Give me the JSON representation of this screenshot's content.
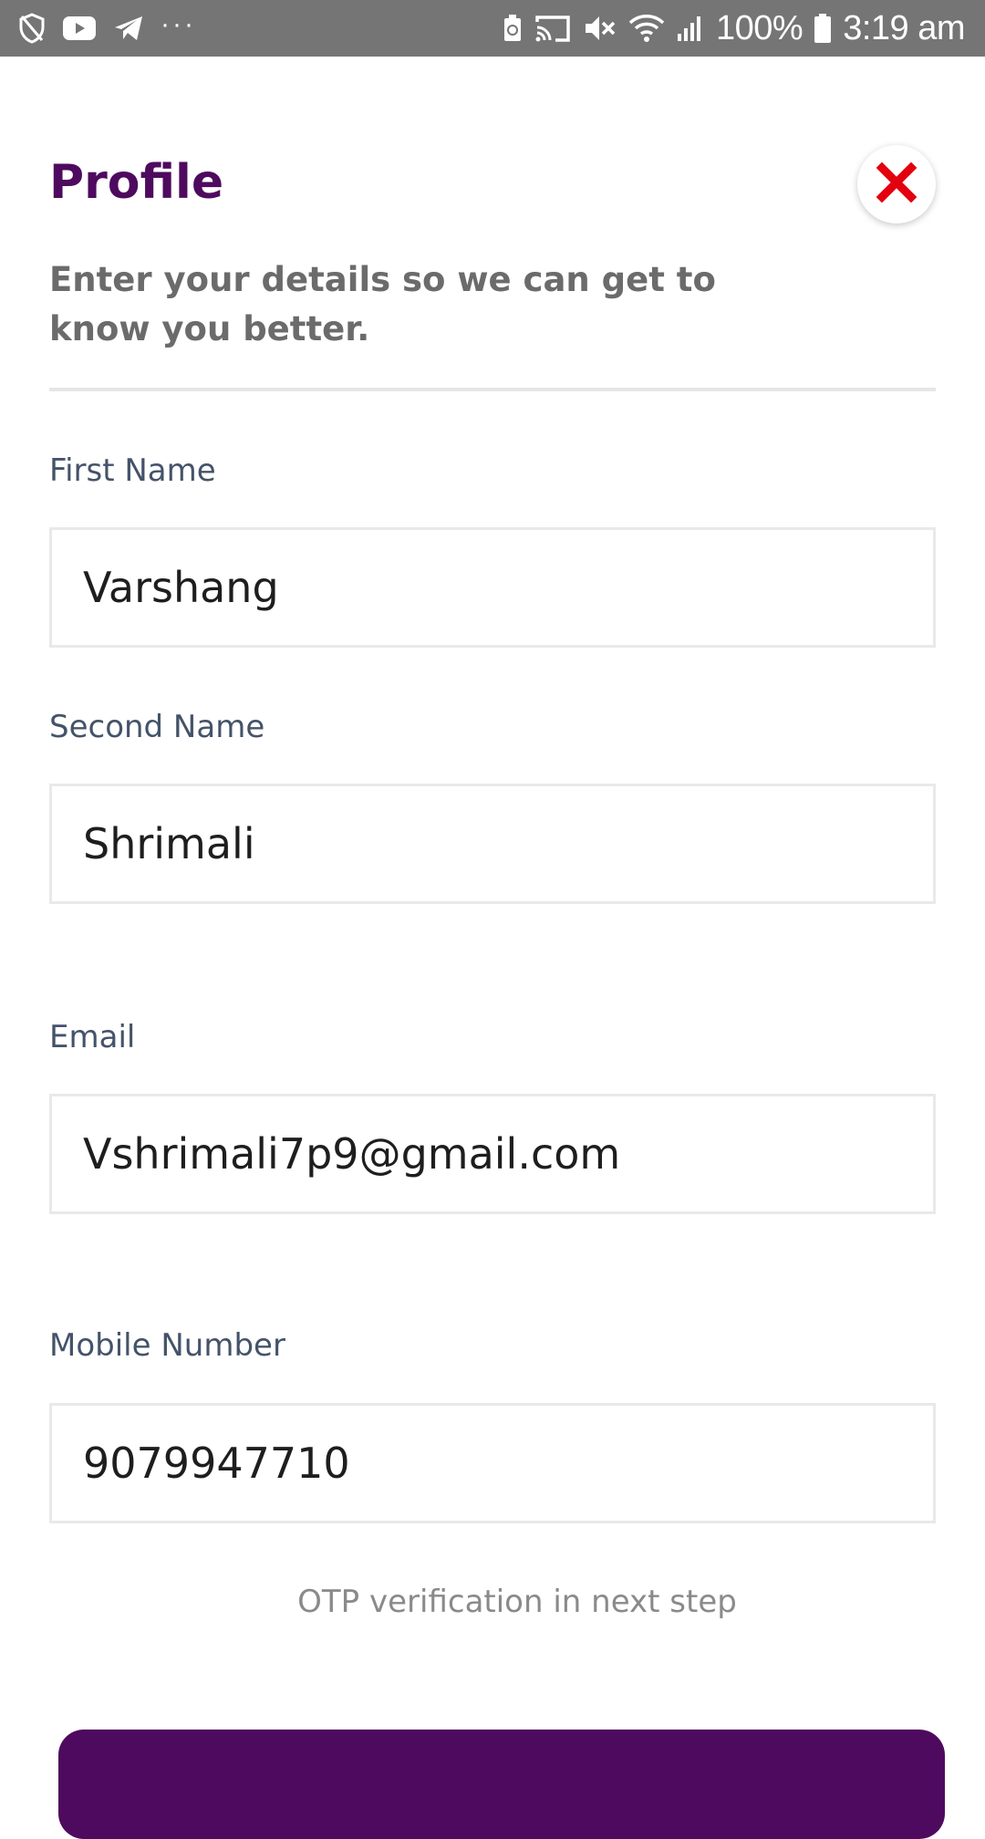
{
  "status_bar": {
    "left_icons": [
      "shield-icon",
      "youtube-icon",
      "telegram-icon",
      "more-notifications-icon"
    ],
    "more_dots": "···",
    "right_icons": [
      "battery-saver-icon",
      "cast-icon",
      "mute-icon",
      "wifi-icon",
      "signal-icon",
      "battery-icon"
    ],
    "battery_percent": "100%",
    "time": "3:19 am"
  },
  "header": {
    "title": "Profile",
    "subtitle": "Enter your details so we can get to know you better."
  },
  "form": {
    "first_name": {
      "label": "First Name",
      "value": "Varshang"
    },
    "second_name": {
      "label": "Second Name",
      "value": "Shrimali"
    },
    "email": {
      "label": "Email",
      "value": "Vshrimali7p9@gmail.com"
    },
    "mobile": {
      "label": "Mobile Number",
      "value": "9079947710"
    },
    "otp_note": "OTP verification in next step"
  },
  "colors": {
    "brand": "#4e0a5e",
    "close_icon": "#e3000f",
    "status_bar": "#757575"
  }
}
